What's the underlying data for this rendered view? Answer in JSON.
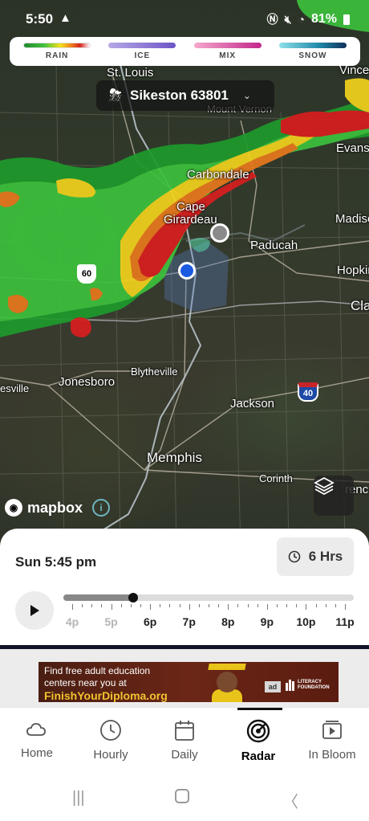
{
  "status_bar": {
    "time": "5:50",
    "battery": "81%"
  },
  "legend": {
    "items": [
      {
        "label": "RAIN",
        "color": "linear-gradient(90deg,#1e8a2c 0%,#3fc13f 30%,#f3e21c 55%,#f08a1c 70%,#d8241c 85%,#ffffff 100%)"
      },
      {
        "label": "ICE",
        "color": "linear-gradient(90deg,#b7a8e6 0%,#6d55c7 100%)"
      },
      {
        "label": "MIX",
        "color": "linear-gradient(90deg,#f5a8cc 0%,#c2278a 100%)"
      },
      {
        "label": "SNOW",
        "color": "linear-gradient(90deg,#8ee0e8 0%,#1f88a8 60%,#12305a 100%)"
      }
    ]
  },
  "location": {
    "name": "Sikeston 63801"
  },
  "map_labels": {
    "st_louis": "St. Louis",
    "mount_vernon": "Mount Vernon",
    "evansville": "Evansv",
    "vincennes": "Vince",
    "carbondale": "Carbondale",
    "cape": "Cape",
    "girardeau": "Girardeau",
    "madison": "Madiso",
    "paducah": "Paducah",
    "hopkinsville": "Hopkin",
    "clarksville": "Cla",
    "blytheville": "Blytheville",
    "jonesboro": "Jonesboro",
    "batesville": "esville",
    "jackson": "Jackson",
    "memphis": "Memphis",
    "corinth": "Corinth",
    "florence": "renc",
    "us60": "60",
    "i40": "40"
  },
  "attribution": {
    "brand": "mapbox"
  },
  "timeline": {
    "datetime": "Sun 5:45 pm",
    "range_label": "6 Hrs",
    "progress_fraction": 0.24,
    "hours": [
      {
        "label": "4p",
        "past": true
      },
      {
        "label": "5p",
        "past": true
      },
      {
        "label": "6p",
        "past": false
      },
      {
        "label": "7p",
        "past": false
      },
      {
        "label": "8p",
        "past": false
      },
      {
        "label": "9p",
        "past": false
      },
      {
        "label": "10p",
        "past": false
      },
      {
        "label": "11p",
        "past": false
      }
    ]
  },
  "ad": {
    "line1": "Find free adult education",
    "line2": "centers near you at",
    "cta": "FinishYourDiploma.org",
    "ad_badge": "ad",
    "sponsor_line1": "LITERACY",
    "sponsor_line2": "FOUNDATION"
  },
  "nav": {
    "items": [
      {
        "label": "Home",
        "icon": "cloud-sun-icon"
      },
      {
        "label": "Hourly",
        "icon": "clock-icon"
      },
      {
        "label": "Daily",
        "icon": "calendar-icon"
      },
      {
        "label": "Radar",
        "icon": "radar-icon"
      },
      {
        "label": "In Bloom",
        "icon": "video-icon"
      }
    ],
    "active": "Radar"
  }
}
